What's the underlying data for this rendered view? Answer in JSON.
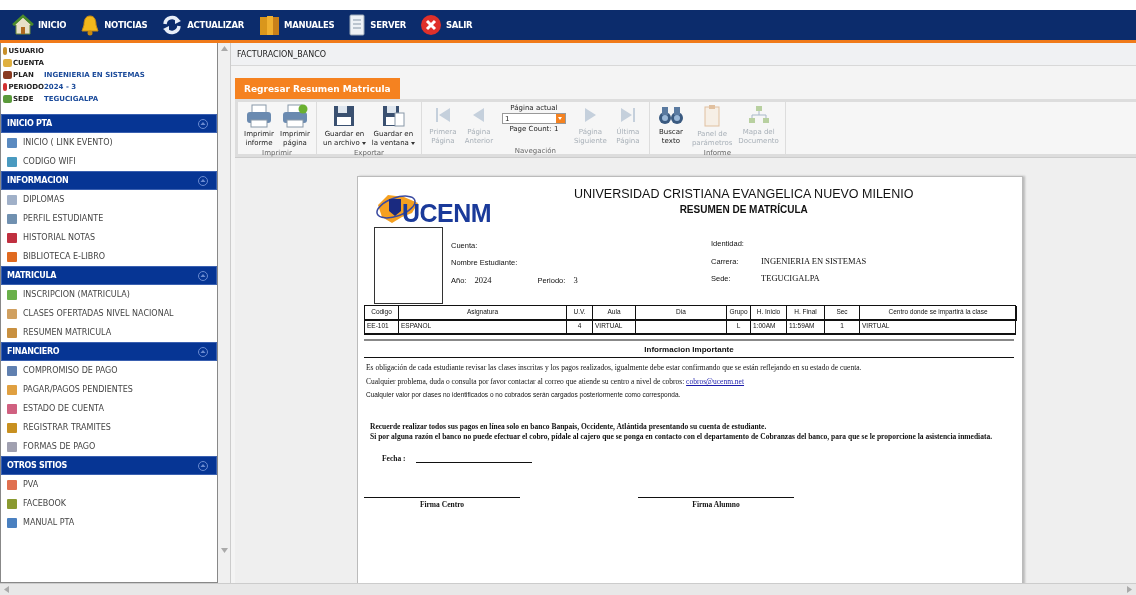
{
  "top_nav": [
    {
      "label": "INICIO"
    },
    {
      "label": "NOTICIAS"
    },
    {
      "label": "ACTUALIZAR"
    },
    {
      "label": "MANUALES"
    },
    {
      "label": "SERVER"
    },
    {
      "label": "SALIR"
    }
  ],
  "user_info": [
    {
      "label": "USUARIO"
    },
    {
      "label": "CUENTA"
    },
    {
      "label": "PLAN",
      "value": "INGENIERIA EN SISTEMAS"
    },
    {
      "label": "PERIODO",
      "value": "2024 - 3"
    },
    {
      "label": "SEDE",
      "value": "TEGUCIGALPA"
    }
  ],
  "sidebar": [
    {
      "title": "INICIO PTA",
      "expanded": true,
      "items": [
        "INICIO ( LINK EVENTO)",
        "CODIGO WIFI"
      ]
    },
    {
      "title": "INFORMACION",
      "expanded": true,
      "items": [
        "DIPLOMAS",
        "PERFIL ESTUDIANTE",
        "HISTORIAL NOTAS",
        "BIBLIOTECA E-LIBRO"
      ]
    },
    {
      "title": "MATRICULA",
      "expanded": true,
      "items": [
        "INSCRIPCION (MATRICULA)",
        "CLASES OFERTADAS NIVEL NACIONAL",
        "RESUMEN MATRICULA"
      ]
    },
    {
      "title": "FINANCIERO",
      "expanded": true,
      "items": [
        "COMPROMISO DE PAGO",
        "PAGAR/PAGOS PENDIENTES",
        "ESTADO DE CUENTA",
        "REGISTRAR TRAMITES",
        "FORMAS DE PAGO"
      ]
    },
    {
      "title": "OTROS SITIOS",
      "expanded": true,
      "items": [
        "PVA",
        "FACEBOOK",
        "MANUAL PTA"
      ]
    }
  ],
  "tab_title": "FACTURACION_BANCO",
  "back_button": "Regresar Resumen Matricula",
  "toolbar": [
    {
      "group": "Imprimir",
      "buttons": [
        {
          "lines": [
            "Imprimir",
            "informe"
          ],
          "disabled": false,
          "dropdown": false
        },
        {
          "lines": [
            "Imprimir",
            "página"
          ],
          "disabled": false,
          "dropdown": false
        }
      ]
    },
    {
      "group": "Exportar",
      "buttons": [
        {
          "lines": [
            "Guardar en",
            "un archivo"
          ],
          "disabled": false,
          "dropdown": true
        },
        {
          "lines": [
            "Guardar en",
            "la ventana"
          ],
          "disabled": false,
          "dropdown": true
        }
      ]
    },
    {
      "group": "Navegación",
      "buttons": [
        {
          "lines": [
            "Primera",
            "Página"
          ],
          "disabled": true,
          "dropdown": false
        },
        {
          "lines": [
            "Página",
            "Anterior"
          ],
          "disabled": true,
          "dropdown": false
        },
        {
          "lines": [
            "Página",
            "Siguiente"
          ],
          "disabled": true,
          "dropdown": false
        },
        {
          "lines": [
            "Última",
            "Página"
          ],
          "disabled": true,
          "dropdown": false
        }
      ],
      "page_label": "Página actual",
      "page_value": "1",
      "page_count": "Page Count: 1"
    },
    {
      "group": "Informe",
      "buttons": [
        {
          "lines": [
            "Buscar",
            "texto"
          ],
          "disabled": false,
          "dropdown": false
        },
        {
          "lines": [
            "Panel de",
            "parámetros"
          ],
          "disabled": true,
          "dropdown": false
        },
        {
          "lines": [
            "Mapa del",
            "Documento"
          ],
          "disabled": true,
          "dropdown": false
        }
      ]
    }
  ],
  "report": {
    "logo_text": "UCENM",
    "title": "UNIVERSIDAD CRISTIANA EVANGELICA NUEVO MILENIO",
    "subtitle": "RESUMEN DE MATRÍCULA",
    "fields_left": [
      {
        "label": "Cuenta:"
      },
      {
        "label": "Nombre Estudiante:"
      }
    ],
    "year_label": "Año:",
    "year": "2024",
    "period_label": "Periodo:",
    "period": "3",
    "fields_right": [
      {
        "label": "Identidad:"
      },
      {
        "label": "Carrera:",
        "value": "INGENIERIA EN SISTEMAS"
      },
      {
        "label": "Sede:",
        "value": "TEGUCIGALPA"
      }
    ],
    "table": {
      "columns": [
        "Codigo",
        "Asignatura",
        "U.V.",
        "Aula",
        "Dia",
        "Grupo",
        "H. Inicio",
        "H. Final",
        "Sec",
        "Centro donde se impartirá la clase"
      ],
      "rows": [
        [
          "EE-101",
          "ESPANOL",
          "4",
          "VIRTUAL",
          "",
          "L",
          "1:00AM",
          "11:59AM",
          "1",
          "VIRTUAL"
        ]
      ]
    },
    "info_title": "Informacion Importante",
    "notes": [
      {
        "text": "Es obligación de cada estudiante revisar las clases inscritas y los pagos realizados, igualmente debe estar confirmando que se están reflejando en su estado de cuenta."
      },
      {
        "text": "Cualquier problema, duda o consulta por favor contactar al correo que atiende su centro a nivel de cobros: ",
        "link": "cobros@ucenm.net"
      },
      {
        "text": "Cualquier valor por clases no identificados o no cobrados serán cargados posteriormente como corresponda.",
        "kind": "small"
      }
    ],
    "notice": [
      "Recuerde realizar todos sus pagos en línea solo en banco Banpais, Occidente, Atlántida presentando su cuenta de estudiante.",
      "Si por alguna razón el banco no puede efectuar el cobro, pídale al cajero que se ponga en contacto con el departamento de Cobranzas del banco, para que se le proporcione la asistencia inmediata."
    ],
    "date_label": "Fecha :",
    "signatures": [
      "Firma Centro",
      "Firma Alumno"
    ]
  }
}
